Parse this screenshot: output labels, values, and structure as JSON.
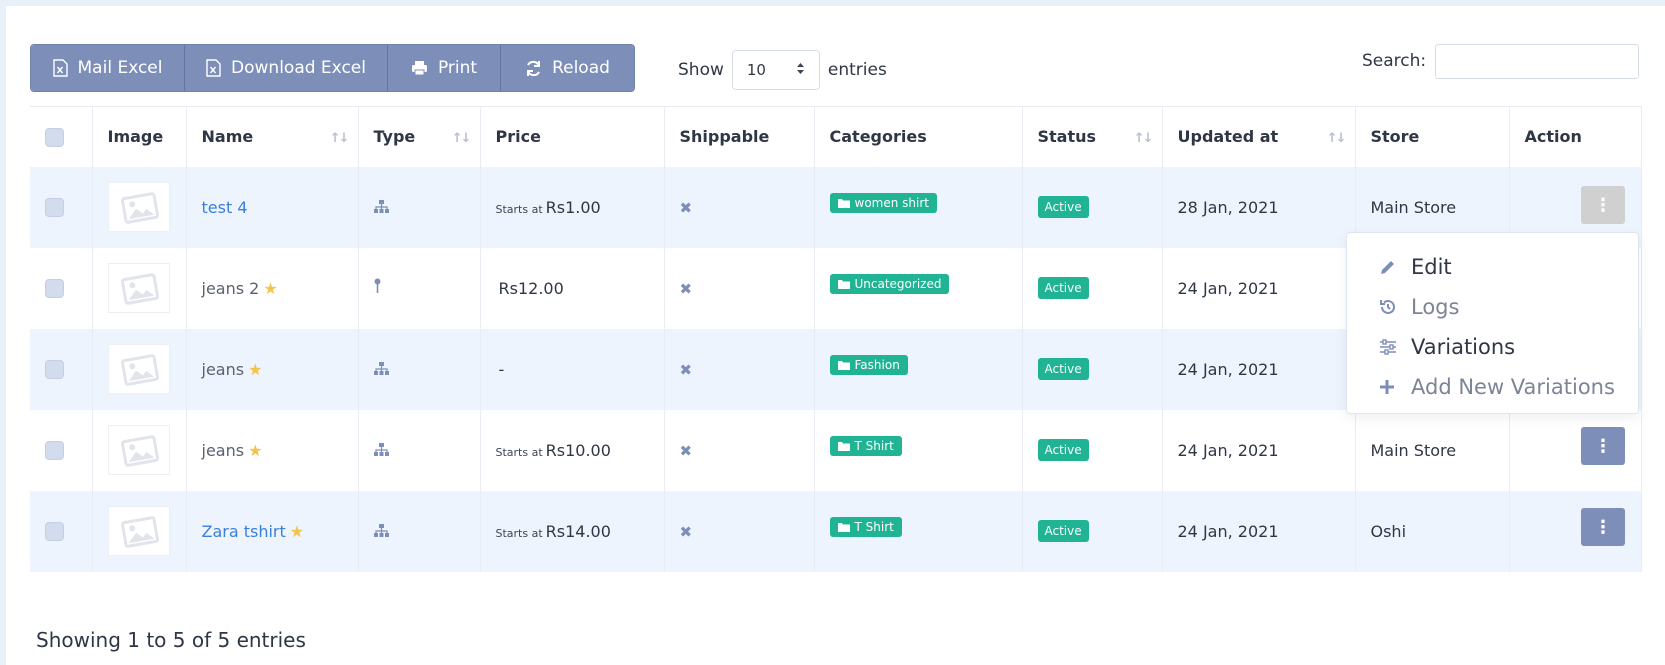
{
  "toolbar": {
    "mail_excel": "Mail Excel",
    "download_excel": "Download Excel",
    "print": "Print",
    "reload": "Reload"
  },
  "length": {
    "show_label": "Show",
    "value": "10",
    "entries_label": "entries"
  },
  "search": {
    "label": "Search:",
    "value": ""
  },
  "columns": {
    "image": "Image",
    "name": "Name",
    "type": "Type",
    "price": "Price",
    "shippable": "Shippable",
    "categories": "Categories",
    "status": "Status",
    "updated_at": "Updated at",
    "store": "Store",
    "action": "Action"
  },
  "rows": [
    {
      "name": "test 4",
      "linked": true,
      "featured": false,
      "type_icon": "sitemap-icon",
      "price_prefix": "Starts at",
      "price": "Rs1.00",
      "category": "women shirt",
      "status": "Active",
      "updated": "28 Jan, 2021",
      "store": "Main Store"
    },
    {
      "name": "jeans 2",
      "linked": false,
      "featured": true,
      "type_icon": "pin-icon",
      "price_prefix": "",
      "price": "Rs12.00",
      "category": "Uncategorized",
      "status": "Active",
      "updated": "24 Jan, 2021",
      "store": ""
    },
    {
      "name": "jeans",
      "linked": false,
      "featured": true,
      "type_icon": "sitemap-icon",
      "price_prefix": "",
      "price": "-",
      "category": "Fashion",
      "status": "Active",
      "updated": "24 Jan, 2021",
      "store": ""
    },
    {
      "name": "jeans",
      "linked": false,
      "featured": true,
      "type_icon": "sitemap-icon",
      "price_prefix": "Starts at",
      "price": "Rs10.00",
      "category": "T Shirt",
      "status": "Active",
      "updated": "24 Jan, 2021",
      "store": "Main Store"
    },
    {
      "name": "Zara tshirt",
      "linked": true,
      "featured": true,
      "type_icon": "sitemap-icon",
      "price_prefix": "Starts at",
      "price": "Rs14.00",
      "category": "T Shirt",
      "status": "Active",
      "updated": "24 Jan, 2021",
      "store": "Oshi"
    }
  ],
  "action_menu": {
    "edit": "Edit",
    "logs": "Logs",
    "variations": "Variations",
    "add_new_variations": "Add New Variations"
  },
  "footer": {
    "info": "Showing 1 to 5 of 5 entries"
  },
  "colors": {
    "toolbar_button": "#7d8fb8",
    "badge_green": "#20b394",
    "link_blue": "#3a7fe0",
    "row_stripe": "#eef4fd",
    "star": "#f4c34a"
  }
}
